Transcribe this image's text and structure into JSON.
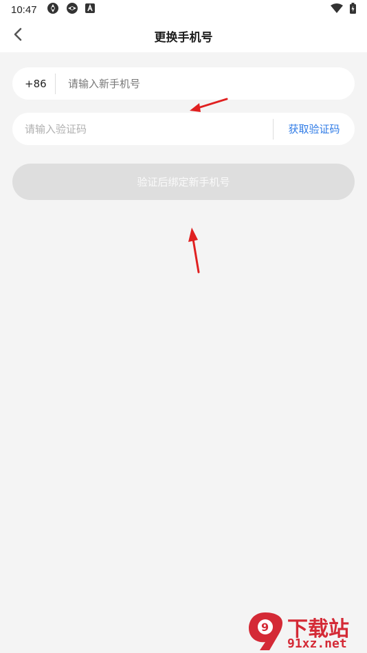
{
  "status_bar": {
    "time": "10:47",
    "icons": [
      "app-icon-1",
      "app-icon-2",
      "a-icon"
    ],
    "right_icons": [
      "wifi-icon",
      "battery-icon"
    ]
  },
  "header": {
    "title": "更换手机号",
    "back_icon": "chevron-left-icon"
  },
  "phone_field": {
    "country_code": "+86",
    "placeholder": "请输入新手机号",
    "value": ""
  },
  "code_field": {
    "placeholder": "请输入验证码",
    "value": "",
    "get_code_label": "获取验证码"
  },
  "submit": {
    "label": "验证后绑定新手机号",
    "enabled": false
  },
  "watermark": {
    "brand": "下载站",
    "domain": "91xz.net",
    "logo": "9"
  },
  "colors": {
    "accent": "#2f7be6",
    "background": "#f4f4f4",
    "disabled_button": "#dedede",
    "annotation_arrow": "#e02020",
    "watermark": "#d42a36"
  }
}
